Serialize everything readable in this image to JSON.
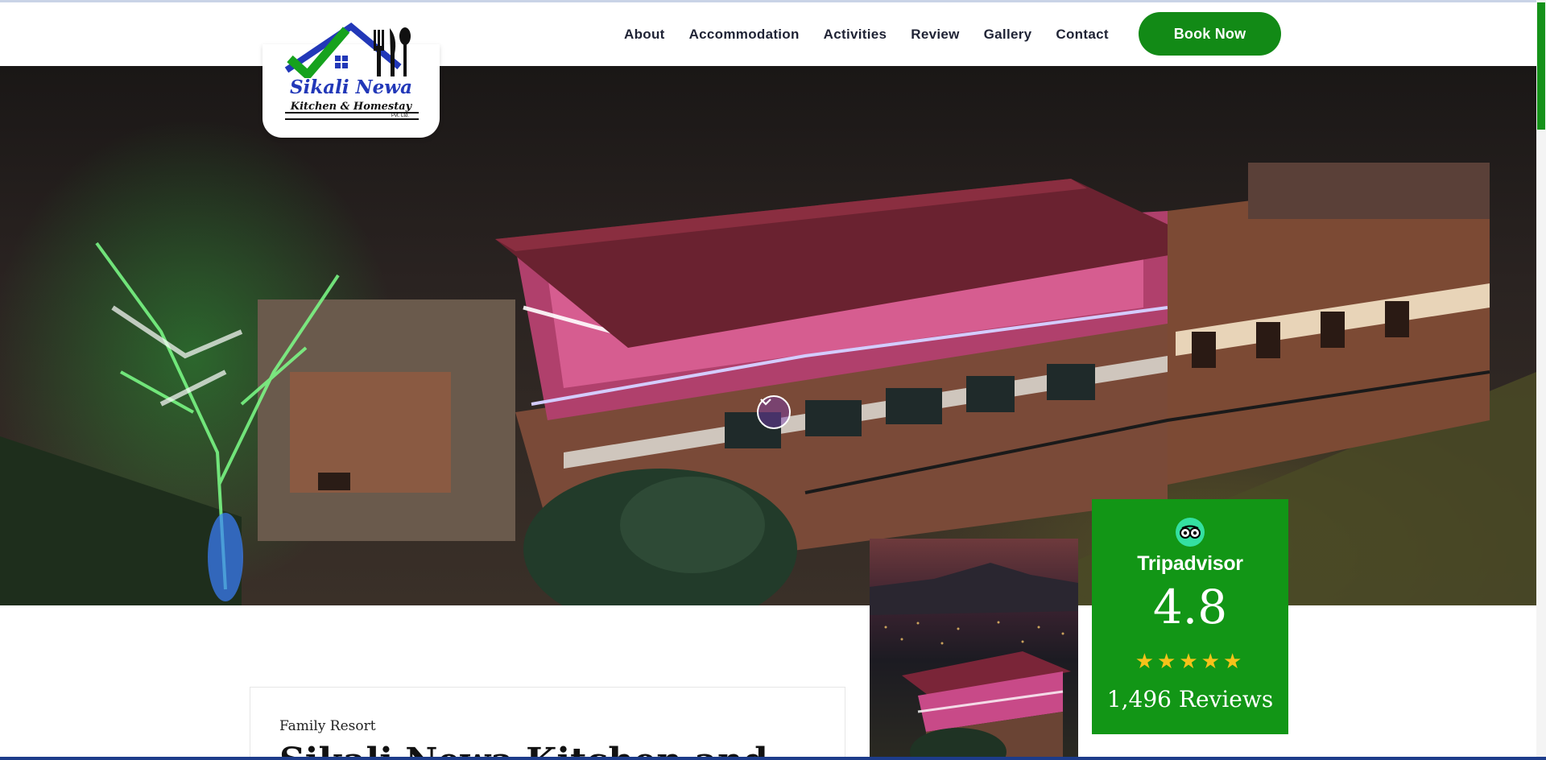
{
  "brand": {
    "name": "Sikali Newa",
    "tagline": "Kitchen & Homestay",
    "suffix": "Pvt. Ltd."
  },
  "nav": {
    "items": [
      {
        "label": "About"
      },
      {
        "label": "Accommodation"
      },
      {
        "label": "Activities"
      },
      {
        "label": "Review"
      },
      {
        "label": "Gallery"
      },
      {
        "label": "Contact"
      }
    ],
    "cta_label": "Book Now"
  },
  "hero": {
    "scroll_icon": "chevron-down-icon"
  },
  "intro": {
    "eyebrow": "Family Resort",
    "title": "Sikali Newa Kitchen and"
  },
  "tripadvisor": {
    "wordmark": "Tripadvisor",
    "rating": "4.8",
    "stars": 5,
    "reviews": "1,496 Reviews",
    "icon": "tripadvisor-owl-icon"
  },
  "colors": {
    "brand_green": "#128a16",
    "card_green": "#129616",
    "nav_text": "#1f2335",
    "star_yellow": "#f6c21a",
    "logo_blue": "#2238b8"
  }
}
